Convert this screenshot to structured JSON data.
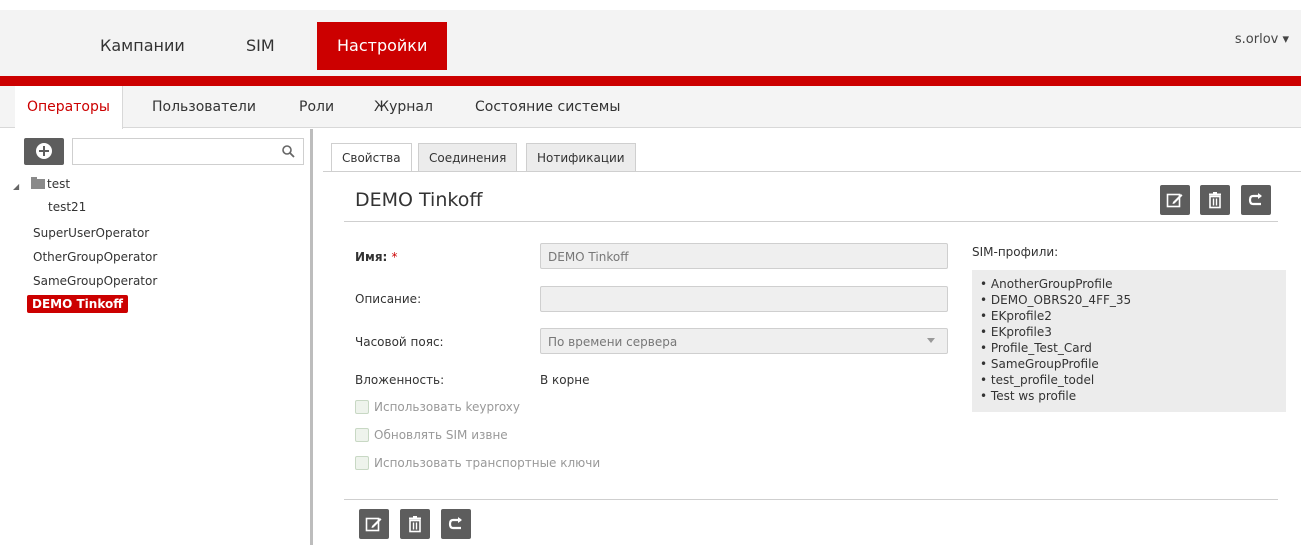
{
  "topnav": {
    "items": [
      "Кампании",
      "SIM",
      "Настройки"
    ],
    "active": "Настройки",
    "user": "s.orlov ▾"
  },
  "subnav": {
    "items": [
      "Операторы",
      "Пользователи",
      "Роли",
      "Журнал",
      "Состояние системы"
    ],
    "active": "Операторы"
  },
  "sidebar": {
    "search_placeholder": "",
    "tree": [
      {
        "label": "test",
        "type": "folder",
        "expanded": true
      },
      {
        "label": "test21",
        "type": "item",
        "indent": 1
      },
      {
        "label": "SuperUserOperator",
        "type": "item"
      },
      {
        "label": "OtherGroupOperator",
        "type": "item"
      },
      {
        "label": "SameGroupOperator",
        "type": "item"
      },
      {
        "label": "DEMO Tinkoff",
        "type": "item",
        "selected": true
      }
    ]
  },
  "tabs": [
    "Свойства",
    "Соединения",
    "Нотификации"
  ],
  "active_tab": "Свойства",
  "operator": {
    "title": "DEMO Tinkoff",
    "name_label": "Имя:",
    "required_mark": "*",
    "name_value": "DEMO Tinkoff",
    "description_label": "Описание:",
    "description_value": "",
    "timezone_label": "Часовой пояс:",
    "timezone_value": "По времени сервера",
    "nesting_label": "Вложенность:",
    "nesting_value": "В корне",
    "checkboxes": [
      {
        "label": "Использовать keyproxy",
        "checked": false
      },
      {
        "label": "Обновлять SIM извне",
        "checked": false
      },
      {
        "label": "Использовать транспортные ключи",
        "checked": false
      }
    ]
  },
  "sim_profiles": {
    "title": "SIM-профили:",
    "items": [
      "AnotherGroupProfile",
      "DEMO_OBRS20_4FF_35",
      "EKprofile2",
      "EKprofile3",
      "Profile_Test_Card",
      "SameGroupProfile",
      "test_profile_todel",
      "Test ws profile"
    ]
  },
  "colors": {
    "accent": "#cc0000",
    "button_dark": "#5d5d5d",
    "header_bg": "#f3f3f3"
  },
  "icons": {
    "add": "plus-circle-icon",
    "search": "magnifier-icon",
    "edit": "edit-icon",
    "delete": "trash-icon",
    "refresh": "redo-icon"
  }
}
